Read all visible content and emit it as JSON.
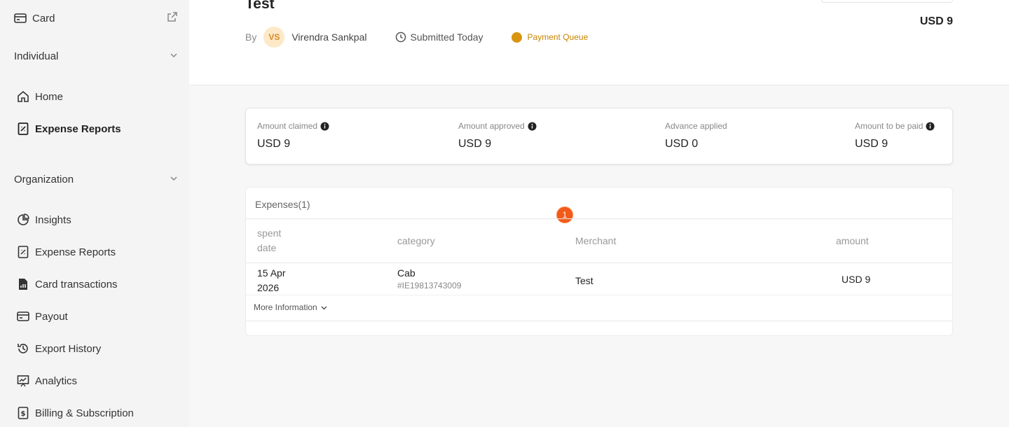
{
  "sidebar": {
    "card_label": "Card",
    "individual_label": "Individual",
    "individual_items": [
      {
        "label": "Home"
      },
      {
        "label": "Expense Reports"
      }
    ],
    "organization_label": "Organization",
    "organization_items": [
      {
        "label": "Insights"
      },
      {
        "label": "Expense Reports"
      },
      {
        "label": "Card transactions"
      },
      {
        "label": "Payout"
      },
      {
        "label": "Export History"
      },
      {
        "label": "Analytics"
      },
      {
        "label": "Billing & Subscription"
      }
    ]
  },
  "header": {
    "title": "Test",
    "by_label": "By",
    "avatar_initials": "VS",
    "submitter_name": "Virendra Sankpal",
    "submitted_text": "Submitted Today",
    "status_text": "Payment Queue",
    "total": "USD 9"
  },
  "summary": {
    "items": [
      {
        "label": "Amount claimed",
        "value": "USD 9"
      },
      {
        "label": "Amount approved",
        "value": "USD 9"
      },
      {
        "label": "Advance applied",
        "value": "USD 0"
      },
      {
        "label": "Amount to be paid",
        "value": "USD 9"
      }
    ]
  },
  "expenses": {
    "title": "Expenses(1)",
    "badge": "1",
    "columns": {
      "spent_line1": "spent",
      "spent_line2": "date",
      "category": "category",
      "merchant": "Merchant",
      "amount": "amount"
    },
    "rows": [
      {
        "date_line1": "15 Apr",
        "date_line2": "2026",
        "category": "Cab",
        "expense_id": "#IE19813743009",
        "merchant": "Test",
        "amount": "USD 9"
      }
    ],
    "more_info_label": "More Information"
  },
  "colors": {
    "status": "#d99510",
    "badge": "#f15a1a",
    "avatar_bg": "#fde9c8"
  }
}
